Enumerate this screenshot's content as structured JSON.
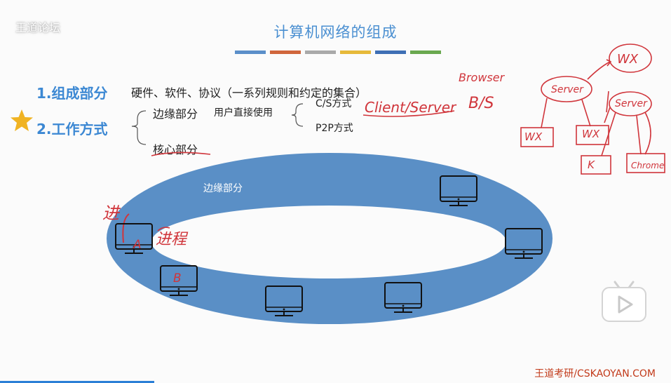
{
  "watermark": "王道论坛",
  "title": "计算机网络的组成",
  "color_bars": [
    "#5b8fc9",
    "#d0663c",
    "#a9a9a9",
    "#e6b93a",
    "#3f6fb5",
    "#6aa84f"
  ],
  "sections": {
    "s1_heading": "1.组成部分",
    "s1_text": "硬件、软件、协议（一系列规则和约定的集合）",
    "s2_heading": "2.工作方式",
    "edge_label": "边缘部分",
    "edge_desc": "用户直接使用",
    "cs_label": "C/S方式",
    "p2p_label": "P2P方式",
    "core_label": "核心部分"
  },
  "diagram": {
    "ring_label": "边缘部分"
  },
  "handwriting": {
    "client_server": "Client/Server",
    "browser": "Browser",
    "bs": "B/S",
    "server": "Server",
    "wx": "WX",
    "k": "K",
    "chrome": "Chrome",
    "a": "A",
    "b": "B",
    "jin": "进",
    "process": "进程"
  },
  "footer": "王道考研/CSKAOYAN.COM",
  "colors": {
    "accent": "#3c88d3",
    "ring": "#5a8fc6",
    "ink": "#d0353b",
    "footer": "#c23a1a"
  },
  "icons": [
    "star-icon",
    "computer-icon",
    "play-icon"
  ]
}
